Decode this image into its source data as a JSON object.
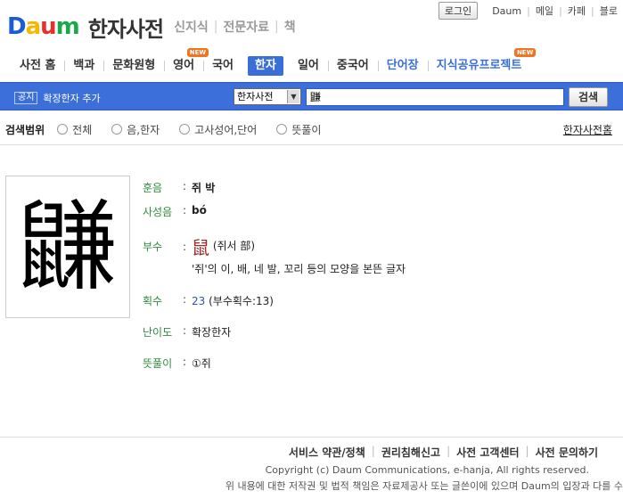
{
  "util": {
    "login": "로그인",
    "links": [
      "Daum",
      "메일",
      "카페",
      "블로"
    ]
  },
  "logo": {
    "brand_letters": [
      "D",
      "a",
      "u",
      "m"
    ],
    "service_title": "한자사전",
    "service_links": [
      "신지식",
      "전문자료",
      "책"
    ]
  },
  "tabs": [
    {
      "label": "사전 홈",
      "active": false,
      "new": false
    },
    {
      "label": "백과",
      "active": false,
      "new": false
    },
    {
      "label": "문화원형",
      "active": false,
      "new": false
    },
    {
      "label": "영어",
      "active": false,
      "new": true
    },
    {
      "label": "국어",
      "active": false,
      "new": false
    },
    {
      "label": "한자",
      "active": true,
      "new": false
    },
    {
      "label": "일어",
      "active": false,
      "new": false
    },
    {
      "label": "중국어",
      "active": false,
      "new": false
    },
    {
      "label": "단어장",
      "active": false,
      "new": false
    },
    {
      "label": "지식공유프로젝트",
      "active": false,
      "new": true
    }
  ],
  "new_badge": "NEW",
  "search": {
    "notice_tag": "공지",
    "notice_text": "확장한자 추가",
    "select_value": "한자사전",
    "input_value": "鼸",
    "button": "검색"
  },
  "scope": {
    "label": "검색범위",
    "options": [
      "전체",
      "음,한자",
      "고사성어,단어",
      "뜻풀이"
    ],
    "home_link": "한자사전홈"
  },
  "entry": {
    "character": "鼸",
    "hunum_label": "훈음",
    "hunum": "쥐 박",
    "pinyin_label": "사성음",
    "pinyin": "bó",
    "radical_label": "부수",
    "radical_char": "鼠",
    "radical_name": "(쥐서 部)",
    "radical_desc": "'쥐'의 이, 배, 네 발, 꼬리 등의 모양을 본뜬 글자",
    "strokes_label": "획수",
    "strokes": "23",
    "strokes_note": "(부수획수:13)",
    "level_label": "난이도",
    "level": "확장한자",
    "meaning_label": "뜻풀이",
    "meaning": "①쥐"
  },
  "footer": {
    "links": [
      "서비스 약관/정책",
      "권리침해신고",
      "사전 고객센터",
      "사전 문의하기"
    ],
    "copyright": "Copyright (c) Daum Communications, e-hanja, All rights reserved.",
    "disclaimer": "위 내용에 대한 저작권 및 법적 책임은 자료제공사 또는 글쓴이에 있으며 Daum의 입장과 다를 수"
  }
}
